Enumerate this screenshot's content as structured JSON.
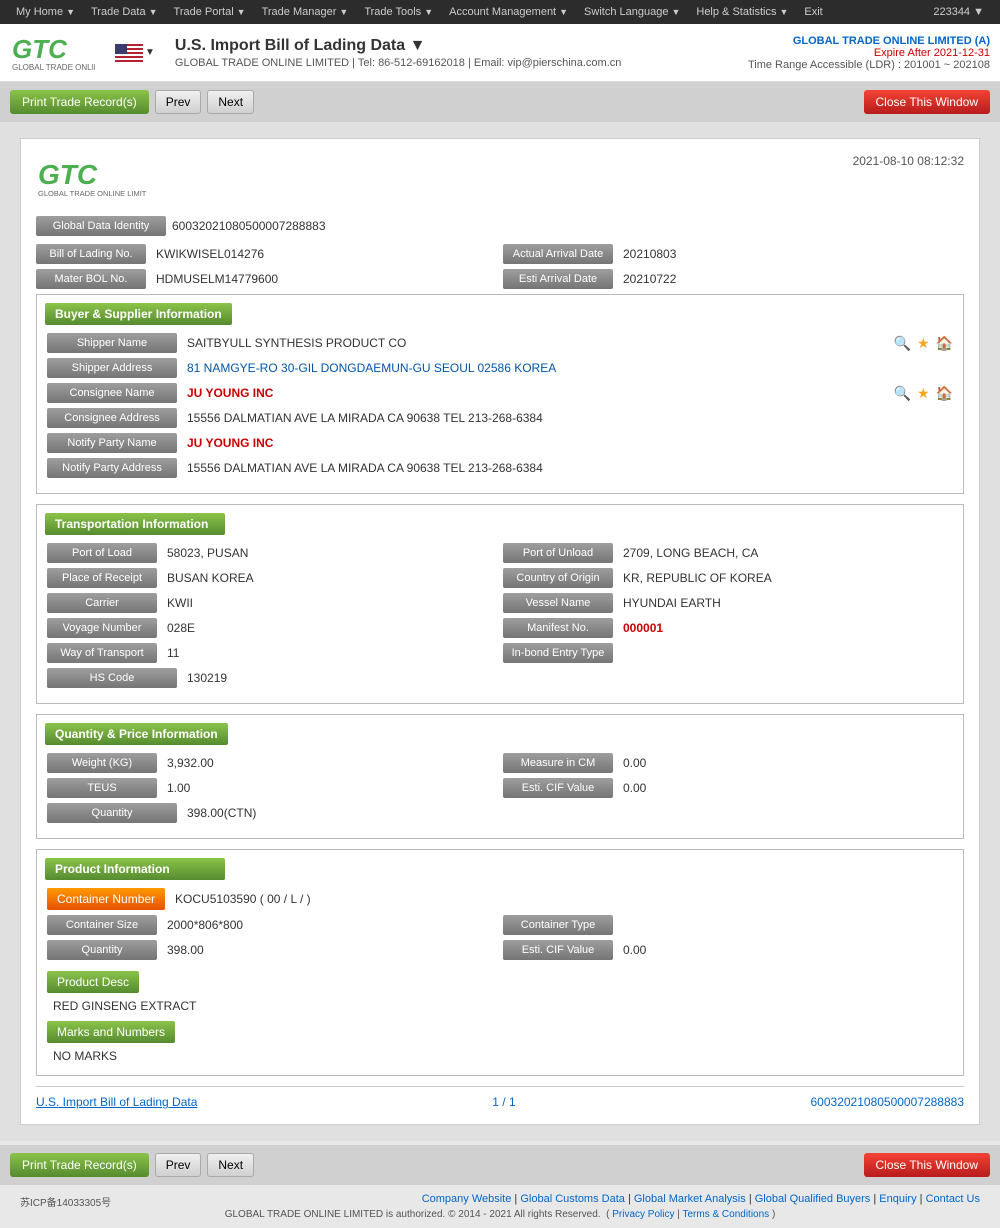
{
  "topNav": {
    "items": [
      {
        "label": "My Home",
        "hasArrow": true
      },
      {
        "label": "Trade Data",
        "hasArrow": true
      },
      {
        "label": "Trade Portal",
        "hasArrow": true
      },
      {
        "label": "Trade Manager",
        "hasArrow": true
      },
      {
        "label": "Trade Tools",
        "hasArrow": true
      },
      {
        "label": "Account Management",
        "hasArrow": true
      },
      {
        "label": "Switch Language",
        "hasArrow": true
      },
      {
        "label": "Help & Statistics",
        "hasArrow": true
      },
      {
        "label": "Exit",
        "hasArrow": false
      }
    ],
    "accountNumber": "223344 ▼"
  },
  "header": {
    "title": "U.S. Import Bill of Lading Data ▼",
    "subtitle": "GLOBAL TRADE ONLINE LIMITED | Tel: 86-512-69162018 | Email: vip@pierschina.com.cn",
    "company": "GLOBAL TRADE ONLINE LIMITED (A)",
    "expire": "Expire After 2021-12-31",
    "timeRange": "Time Range Accessible (LDR) : 201001 ~ 202108"
  },
  "toolbar": {
    "printLabel": "Print Trade Record(s)",
    "prevLabel": "Prev",
    "nextLabel": "Next",
    "closeLabel": "Close This Window"
  },
  "card": {
    "date": "2021-08-10 08:12:32",
    "globalDataIdentity": {
      "label": "Global Data Identity",
      "value": "60032021080500007288883"
    },
    "billOfLading": {
      "label": "Bill of Lading No.",
      "value": "KWIKWISEL014276"
    },
    "actualArrivalDate": {
      "label": "Actual Arrival Date",
      "value": "20210803"
    },
    "masterBOL": {
      "label": "Mater BOL No.",
      "value": "HDMUSELM14779600"
    },
    "estiArrival": {
      "label": "Esti Arrival Date",
      "value": "20210722"
    }
  },
  "buyerSupplier": {
    "sectionTitle": "Buyer & Supplier Information",
    "shipperName": {
      "label": "Shipper Name",
      "value": "SAITBYULL SYNTHESIS PRODUCT CO"
    },
    "shipperAddress": {
      "label": "Shipper Address",
      "value": "81 NAMGYE-RO 30-GIL DONGDAEMUN-GU SEOUL 02586 KOREA"
    },
    "consigneeName": {
      "label": "Consignee Name",
      "value": "JU YOUNG INC"
    },
    "consigneeAddress": {
      "label": "Consignee Address",
      "value": "15556 DALMATIAN AVE LA MIRADA CA 90638 TEL 213-268-6384"
    },
    "notifyPartyName": {
      "label": "Notify Party Name",
      "value": "JU YOUNG INC"
    },
    "notifyPartyAddress": {
      "label": "Notify Party Address",
      "value": "15556 DALMATIAN AVE LA MIRADA CA 90638 TEL 213-268-6384"
    }
  },
  "transportation": {
    "sectionTitle": "Transportation Information",
    "portOfLoad": {
      "label": "Port of Load",
      "value": "58023, PUSAN"
    },
    "portOfUnload": {
      "label": "Port of Unload",
      "value": "2709, LONG BEACH, CA"
    },
    "placeOfReceipt": {
      "label": "Place of Receipt",
      "value": "BUSAN KOREA"
    },
    "countryOfOrigin": {
      "label": "Country of Origin",
      "value": "KR, REPUBLIC OF KOREA"
    },
    "carrier": {
      "label": "Carrier",
      "value": "KWII"
    },
    "vesselName": {
      "label": "Vessel Name",
      "value": "HYUNDAI EARTH"
    },
    "voyageNumber": {
      "label": "Voyage Number",
      "value": "028E"
    },
    "manifestNo": {
      "label": "Manifest No.",
      "value": "000001"
    },
    "wayOfTransport": {
      "label": "Way of Transport",
      "value": "11"
    },
    "inBondEntryType": {
      "label": "In-bond Entry Type",
      "value": ""
    },
    "hsCode": {
      "label": "HS Code",
      "value": "130219"
    }
  },
  "quantity": {
    "sectionTitle": "Quantity & Price Information",
    "weightKG": {
      "label": "Weight (KG)",
      "value": "3,932.00"
    },
    "measureInCM": {
      "label": "Measure in CM",
      "value": "0.00"
    },
    "teus": {
      "label": "TEUS",
      "value": "1.00"
    },
    "estiCIFValue": {
      "label": "Esti. CIF Value",
      "value": "0.00"
    },
    "quantity": {
      "label": "Quantity",
      "value": "398.00(CTN)"
    }
  },
  "product": {
    "sectionTitle": "Product Information",
    "containerNumber": {
      "label": "Container Number",
      "value": "KOCU5103590 ( 00 / L / )"
    },
    "containerSize": {
      "label": "Container Size",
      "value": "2000*806*800"
    },
    "containerType": {
      "label": "Container Type",
      "value": ""
    },
    "quantity": {
      "label": "Quantity",
      "value": "398.00"
    },
    "estiCIFValue": {
      "label": "Esti. CIF Value",
      "value": "0.00"
    },
    "productDescLabel": "Product Desc",
    "productDescValue": "RED GINSENG EXTRACT",
    "marksLabel": "Marks and Numbers",
    "marksValue": "NO MARKS"
  },
  "cardFooter": {
    "linkText": "U.S. Import Bill of Lading Data",
    "pageInfo": "1 / 1",
    "id": "60032021080500007288883"
  },
  "bottomToolbar": {
    "printLabel": "Print Trade Record(s)",
    "prevLabel": "Prev",
    "nextLabel": "Next",
    "closeLabel": "Close This Window"
  },
  "footer": {
    "icp": "苏ICP备14033305号",
    "links": [
      "Company Website",
      "Global Customs Data",
      "Global Market Analysis",
      "Global Qualified Buyers",
      "Enquiry",
      "Contact Us"
    ],
    "copyright": "GLOBAL TRADE ONLINE LIMITED is authorized. © 2014 - 2021 All rights Reserved.",
    "privacy": "Privacy Policy",
    "terms": "Terms & Conditions"
  }
}
